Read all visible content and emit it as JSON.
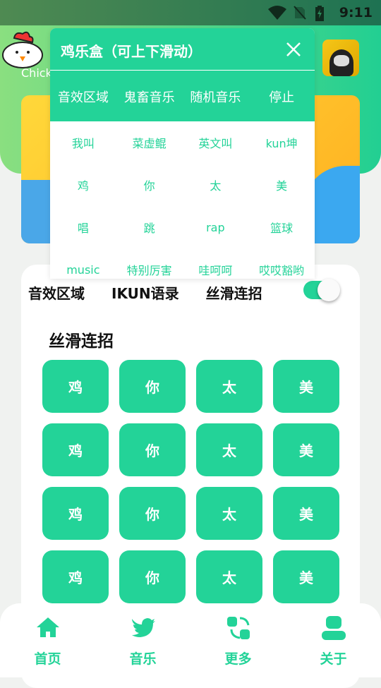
{
  "status_bar": {
    "time": "9:11",
    "icons": [
      "wifi-icon",
      "no-sim-icon",
      "battery-charging-icon"
    ]
  },
  "header": {
    "subtitle": "Chick",
    "avatar": "panda-avatar"
  },
  "tabs": [
    "音效区域",
    "IKUN语录",
    "丝滑连招"
  ],
  "toggle": {
    "on": true
  },
  "section_title": "丝滑连招",
  "grid": [
    [
      "鸡",
      "你",
      "太",
      "美"
    ],
    [
      "鸡",
      "你",
      "太",
      "美"
    ],
    [
      "鸡",
      "你",
      "太",
      "美"
    ],
    [
      "鸡",
      "你",
      "太",
      "美"
    ]
  ],
  "dialog": {
    "title": "鸡乐盒（可上下滑动）",
    "tabs": [
      "音效区域",
      "鬼畜音乐",
      "随机音乐",
      "停止"
    ],
    "items": [
      "我叫",
      "菜虚鲲",
      "英文叫",
      "kun坤",
      "鸡",
      "你",
      "太",
      "美",
      "唱",
      "跳",
      "rap",
      "篮球",
      "music",
      "特别厉害",
      "哇呵呵",
      "哎哎豁哟"
    ]
  },
  "nav": [
    {
      "label": "首页",
      "icon": "home-icon"
    },
    {
      "label": "音乐",
      "icon": "twitter-bird-icon"
    },
    {
      "label": "更多",
      "icon": "swap-grid-icon"
    },
    {
      "label": "关于",
      "icon": "user-icon"
    }
  ],
  "colors": {
    "accent": "#23d398",
    "header_start": "#8adf80"
  }
}
